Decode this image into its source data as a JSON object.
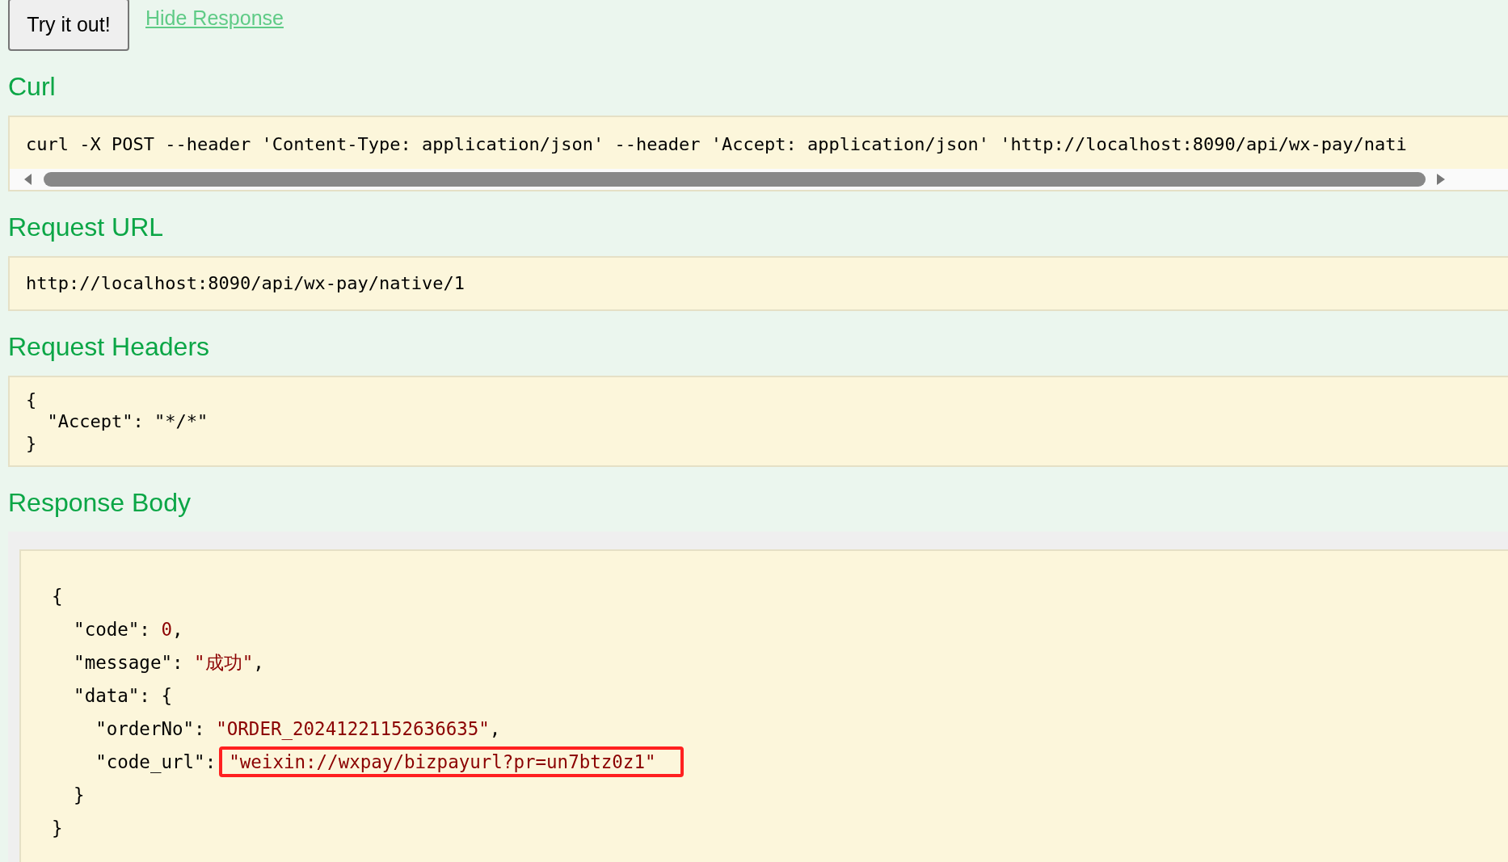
{
  "actions": {
    "button": "Try it out!",
    "link": "Hide Response"
  },
  "curl": {
    "heading": "Curl",
    "command": "curl -X POST --header 'Content-Type: application/json' --header 'Accept: application/json' 'http://localhost:8090/api/wx-pay/nati"
  },
  "request_url": {
    "heading": "Request URL",
    "value": "http://localhost:8090/api/wx-pay/native/1"
  },
  "request_headers": {
    "heading": "Request Headers",
    "lines": [
      "{",
      "  \"Accept\": \"*/*\"",
      "}"
    ]
  },
  "response_body": {
    "heading": "Response Body",
    "lines": [
      [
        {
          "text": "{",
          "kind": "plain"
        }
      ],
      [
        {
          "text": "  \"code\": ",
          "kind": "plain"
        },
        {
          "text": "0",
          "kind": "value"
        },
        {
          "text": ",",
          "kind": "plain"
        }
      ],
      [
        {
          "text": "  \"message\": ",
          "kind": "plain"
        },
        {
          "text": "\"成功\"",
          "kind": "value"
        },
        {
          "text": ",",
          "kind": "plain"
        }
      ],
      [
        {
          "text": "  \"data\": {",
          "kind": "plain"
        }
      ],
      [
        {
          "text": "    \"orderNo\": ",
          "kind": "plain"
        },
        {
          "text": "\"ORDER_20241221152636635\"",
          "kind": "value"
        },
        {
          "text": ",",
          "kind": "plain"
        }
      ],
      [
        {
          "text": "    \"code_url\":",
          "kind": "plain"
        },
        {
          "text": "\"weixin://wxpay/bizpayurl?pr=un7btz0z1\"",
          "kind": "highlight"
        }
      ],
      [
        {
          "text": "  }",
          "kind": "plain"
        }
      ],
      [
        {
          "text": "}",
          "kind": "plain"
        }
      ]
    ]
  }
}
